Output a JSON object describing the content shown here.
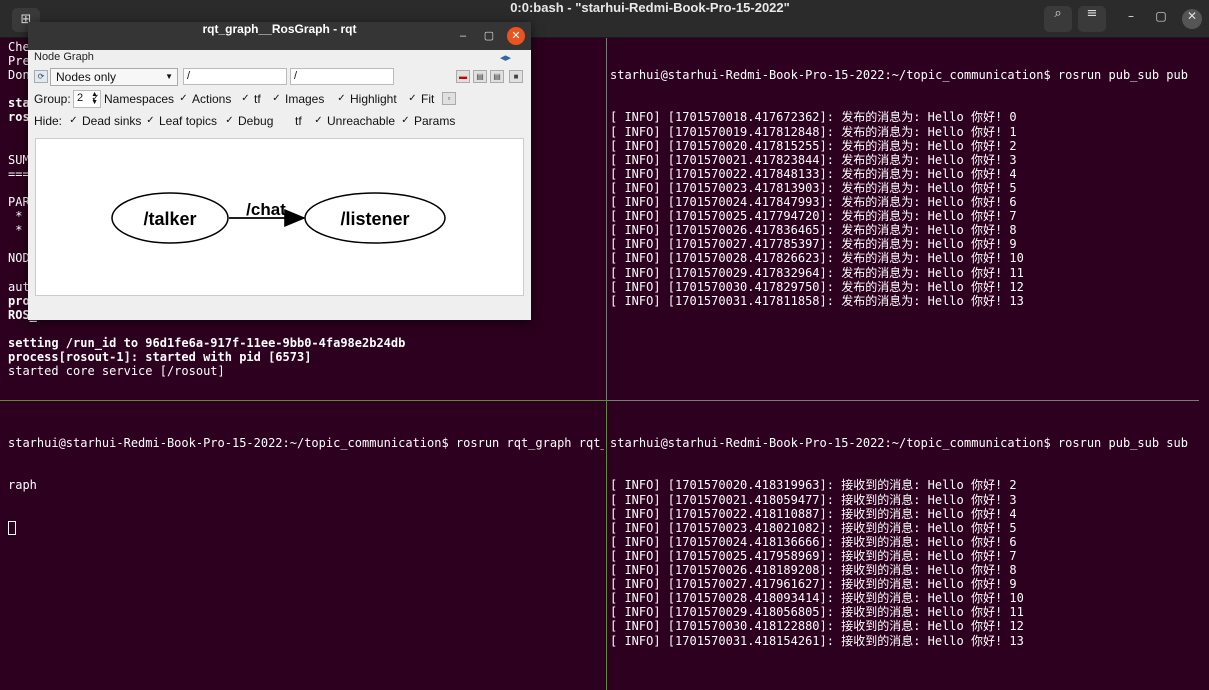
{
  "titlebar": {
    "title": "0:0:bash - \"starhui-Redmi-Book-Pro-15-2022\"",
    "new_tab_icon": "⊞",
    "search_icon": "⌕",
    "menu_icon": "≡",
    "minimize": "–",
    "maximize": "▢",
    "close": "✕"
  },
  "top_left": {
    "lines": [
      "Che",
      "Pre",
      "Don",
      "",
      "sta",
      "ros",
      "",
      "",
      "SUM",
      "===",
      "",
      "PAR",
      " *",
      " *",
      "",
      "NOD",
      "",
      "aut",
      "pro",
      "ROS_",
      "",
      "setting /run_id to 96d1fe6a-917f-11ee-9bb0-4fa98e2b24db",
      "process[rosout-1]: started with pid [6573]",
      "started core service [/rosout]"
    ]
  },
  "top_right": {
    "prompt": "starhui@starhui-Redmi-Book-Pro-15-2022:~/topic_communication$ rosrun pub_sub pub",
    "lines": [
      "[ INFO] [1701570018.417672362]: 发布的消息为: Hello 你好! 0",
      "[ INFO] [1701570019.417812848]: 发布的消息为: Hello 你好! 1",
      "[ INFO] [1701570020.417815255]: 发布的消息为: Hello 你好! 2",
      "[ INFO] [1701570021.417823844]: 发布的消息为: Hello 你好! 3",
      "[ INFO] [1701570022.417848133]: 发布的消息为: Hello 你好! 4",
      "[ INFO] [1701570023.417813903]: 发布的消息为: Hello 你好! 5",
      "[ INFO] [1701570024.417847993]: 发布的消息为: Hello 你好! 6",
      "[ INFO] [1701570025.417794720]: 发布的消息为: Hello 你好! 7",
      "[ INFO] [1701570026.417836465]: 发布的消息为: Hello 你好! 8",
      "[ INFO] [1701570027.417785397]: 发布的消息为: Hello 你好! 9",
      "[ INFO] [1701570028.417826623]: 发布的消息为: Hello 你好! 10",
      "[ INFO] [1701570029.417832964]: 发布的消息为: Hello 你好! 11",
      "[ INFO] [1701570030.417829750]: 发布的消息为: Hello 你好! 12",
      "[ INFO] [1701570031.417811858]: 发布的消息为: Hello 你好! 13"
    ]
  },
  "bottom_left": {
    "prompt": "starhui@starhui-Redmi-Book-Pro-15-2022:~/topic_communication$ rosrun rqt_graph rqt_g",
    "wrap": "raph"
  },
  "bottom_right": {
    "prompt": "starhui@starhui-Redmi-Book-Pro-15-2022:~/topic_communication$ rosrun pub_sub sub",
    "lines": [
      "[ INFO] [1701570020.418319963]: 接收到的消息: Hello 你好! 2",
      "[ INFO] [1701570021.418059477]: 接收到的消息: Hello 你好! 3",
      "[ INFO] [1701570022.418110887]: 接收到的消息: Hello 你好! 4",
      "[ INFO] [1701570023.418021082]: 接收到的消息: Hello 你好! 5",
      "[ INFO] [1701570024.418136666]: 接收到的消息: Hello 你好! 6",
      "[ INFO] [1701570025.417958969]: 接收到的消息: Hello 你好! 7",
      "[ INFO] [1701570026.418189208]: 接收到的消息: Hello 你好! 8",
      "[ INFO] [1701570027.417961627]: 接收到的消息: Hello 你好! 9",
      "[ INFO] [1701570028.418093414]: 接收到的消息: Hello 你好! 10",
      "[ INFO] [1701570029.418056805]: 接收到的消息: Hello 你好! 11",
      "[ INFO] [1701570030.418122880]: 接收到的消息: Hello 你好! 12",
      "[ INFO] [1701570031.418154261]: 接收到的消息: Hello 你好! 13"
    ]
  },
  "rqt": {
    "title": "rqt_graph__RosGraph - rqt",
    "plugin_title": "Node Graph",
    "minimize": "–",
    "maximize": "▢",
    "close": "✕",
    "refresh_icon": "⟳",
    "mode": "Nodes only",
    "filter1": "/",
    "filter2": "/",
    "group_label": "Group:",
    "group_value": "2",
    "options": [
      {
        "label": "Namespaces",
        "checked": true
      },
      {
        "label": "Actions",
        "checked": true
      },
      {
        "label": "tf",
        "checked": true
      },
      {
        "label": "Images",
        "checked": true
      },
      {
        "label": "Highlight",
        "checked": true
      },
      {
        "label": "Fit",
        "checked": true
      }
    ],
    "hide_label": "Hide:",
    "hide": [
      {
        "label": "Dead sinks",
        "checked": true
      },
      {
        "label": "Leaf topics",
        "checked": true
      },
      {
        "label": "Debug",
        "checked": true
      },
      {
        "label": "tf",
        "checked": false
      },
      {
        "label": "Unreachable",
        "checked": true
      },
      {
        "label": "Params",
        "checked": true
      }
    ],
    "graph": {
      "node_a": "/talker",
      "edge": "/chat",
      "node_b": "/listener"
    }
  }
}
